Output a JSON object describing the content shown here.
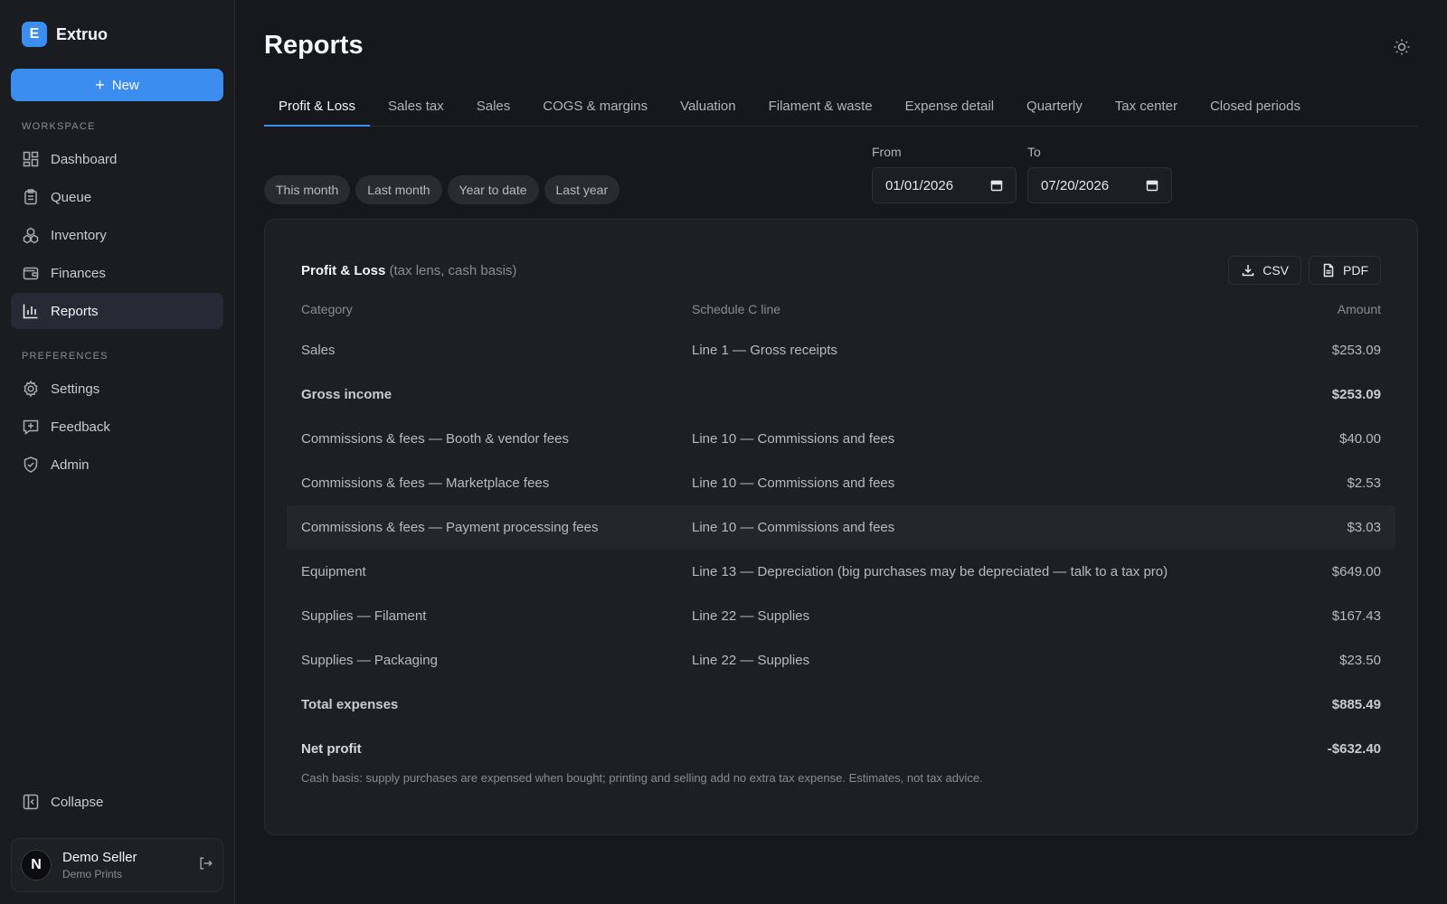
{
  "brand": {
    "logo_letter": "E",
    "name": "Extruo"
  },
  "sidebar": {
    "new_label": "New",
    "workspace_label": "WORKSPACE",
    "workspace_items": [
      {
        "label": "Dashboard",
        "icon": "dashboard-icon"
      },
      {
        "label": "Queue",
        "icon": "clipboard-icon"
      },
      {
        "label": "Inventory",
        "icon": "boxes-icon"
      },
      {
        "label": "Finances",
        "icon": "wallet-icon"
      },
      {
        "label": "Reports",
        "icon": "bar-chart-icon",
        "active": true
      }
    ],
    "preferences_label": "PREFERENCES",
    "preference_items": [
      {
        "label": "Settings",
        "icon": "gear-icon"
      },
      {
        "label": "Feedback",
        "icon": "message-plus-icon"
      },
      {
        "label": "Admin",
        "icon": "shield-icon"
      }
    ],
    "collapse_label": "Collapse",
    "user": {
      "avatar_letter": "N",
      "name": "Demo Seller",
      "org": "Demo Prints"
    }
  },
  "page": {
    "title": "Reports"
  },
  "tabs": [
    "Profit & Loss",
    "Sales tax",
    "Sales",
    "COGS & margins",
    "Valuation",
    "Filament & waste",
    "Expense detail",
    "Quarterly",
    "Tax center",
    "Closed periods"
  ],
  "active_tab": "Profit & Loss",
  "presets": [
    "This month",
    "Last month",
    "Year to date",
    "Last year"
  ],
  "date_range": {
    "from_label": "From",
    "from_value": "01/01/2026",
    "to_label": "To",
    "to_value": "07/20/2026"
  },
  "report": {
    "title": "Profit & Loss",
    "subtitle": "(tax lens, cash basis)",
    "csv_label": "CSV",
    "pdf_label": "PDF",
    "columns": [
      "Category",
      "Schedule C line",
      "Amount"
    ],
    "rows": [
      {
        "category": "Sales",
        "line": "Line 1 — Gross receipts",
        "amount": "$253.09"
      },
      {
        "category": "Gross income",
        "line": "",
        "amount": "$253.09",
        "bold": true
      },
      {
        "category": "Commissions & fees — Booth & vendor fees",
        "line": "Line 10 — Commissions and fees",
        "amount": "$40.00"
      },
      {
        "category": "Commissions & fees — Marketplace fees",
        "line": "Line 10 — Commissions and fees",
        "amount": "$2.53"
      },
      {
        "category": "Commissions & fees — Payment processing fees",
        "line": "Line 10 — Commissions and fees",
        "amount": "$3.03",
        "highlight": true
      },
      {
        "category": "Equipment",
        "line": "Line 13 — Depreciation (big purchases may be depreciated — talk to a tax pro)",
        "amount": "$649.00"
      },
      {
        "category": "Supplies — Filament",
        "line": "Line 22 — Supplies",
        "amount": "$167.43"
      },
      {
        "category": "Supplies — Packaging",
        "line": "Line 22 — Supplies",
        "amount": "$23.50"
      },
      {
        "category": "Total expenses",
        "line": "",
        "amount": "$885.49",
        "bold": true
      },
      {
        "category": "Net profit",
        "line": "",
        "amount": "-$632.40",
        "bold": true
      }
    ],
    "footnote": "Cash basis: supply purchases are expensed when bought; printing and selling add no extra tax expense. Estimates, not tax advice."
  },
  "colors": {
    "accent": "#3b8df0",
    "background": "#17181b",
    "sidebar": "#1b1c20",
    "card": "#1e1f23"
  }
}
